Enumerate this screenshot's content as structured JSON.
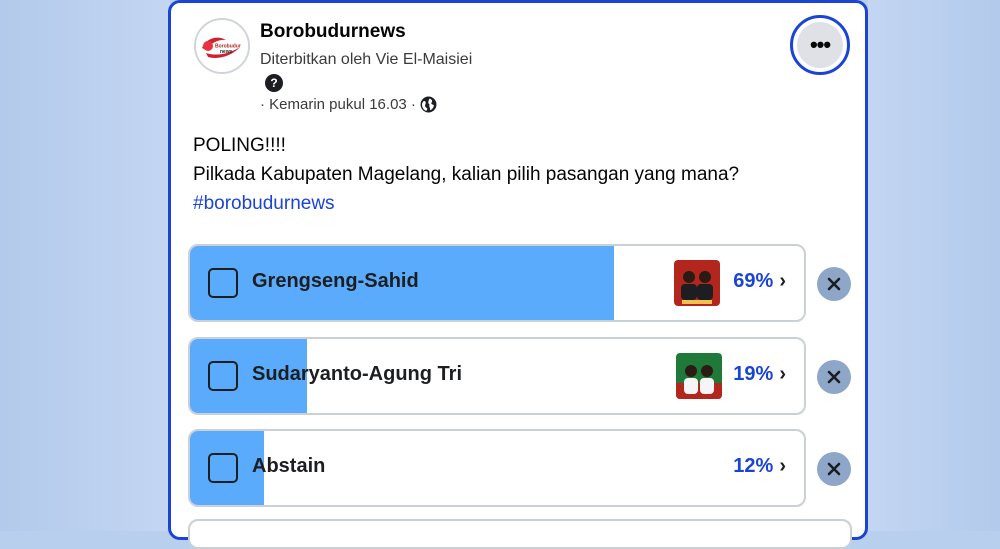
{
  "post": {
    "page_name": "Borobudurnews",
    "published_by": "Diterbitkan oleh Vie El-Maisiei",
    "help_glyph": "?",
    "time": "· Kemarin pukul 16.03 ·",
    "more_glyph": "•••",
    "avatar_logo_text": "Borobudur News",
    "text_line1": "POLING!!!!",
    "text_line2": "Pilkada Kabupaten Magelang, kalian pilih pasangan yang mana?",
    "hashtag": "#borobudurnews",
    "icons": {
      "help": "question-icon",
      "privacy": "globe-icon",
      "more": "more-options-icon",
      "remove": "close-icon",
      "chevron": "chevron-right-icon"
    }
  },
  "poll": {
    "options": [
      {
        "label": "Grengseng-Sahid",
        "percent": "69%",
        "fill": 0.69,
        "has_thumb": true,
        "thumb_color": "#b3261e"
      },
      {
        "label": "Sudaryanto-Agung Tri",
        "percent": "19%",
        "fill": 0.19,
        "has_thumb": true,
        "thumb_color": "#1f7a3a"
      },
      {
        "label": "Abstain",
        "percent": "12%",
        "fill": 0.12,
        "has_thumb": false
      }
    ],
    "chevron_glyph": "›",
    "remove_glyph": "✕"
  },
  "colors": {
    "accent": "#1a44d6",
    "poll_fill": "#5aabfb",
    "background": "#b9cfee"
  }
}
